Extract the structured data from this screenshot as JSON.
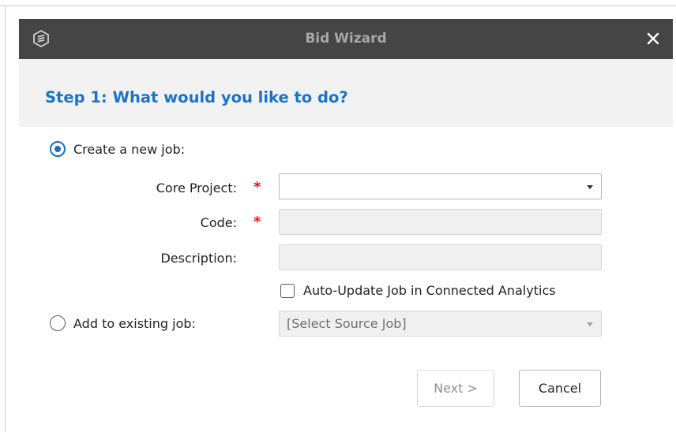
{
  "window": {
    "title": "Bid Wizard",
    "logo_icon": "app-logo-icon",
    "close_icon": "close-icon"
  },
  "step": {
    "title": "Step 1: What would you like to do?"
  },
  "options": {
    "create_new": {
      "label": "Create a new job:",
      "selected": true
    },
    "add_existing": {
      "label": "Add to existing job:",
      "selected": false
    }
  },
  "fields": {
    "core_project": {
      "label": "Core Project:",
      "value": "",
      "required": true
    },
    "code": {
      "label": "Code:",
      "value": "",
      "required": true
    },
    "description": {
      "label": "Description:",
      "value": ""
    },
    "required_marker": "*"
  },
  "auto_update": {
    "label": "Auto-Update Job in Connected Analytics",
    "checked": false
  },
  "source_job": {
    "placeholder": "[Select Source Job]"
  },
  "buttons": {
    "next": "Next >",
    "cancel": "Cancel"
  },
  "colors": {
    "titlebar": "#454545",
    "accent": "#1a73c8",
    "required": "#e8141b",
    "header_bg": "#f2f2f2"
  }
}
